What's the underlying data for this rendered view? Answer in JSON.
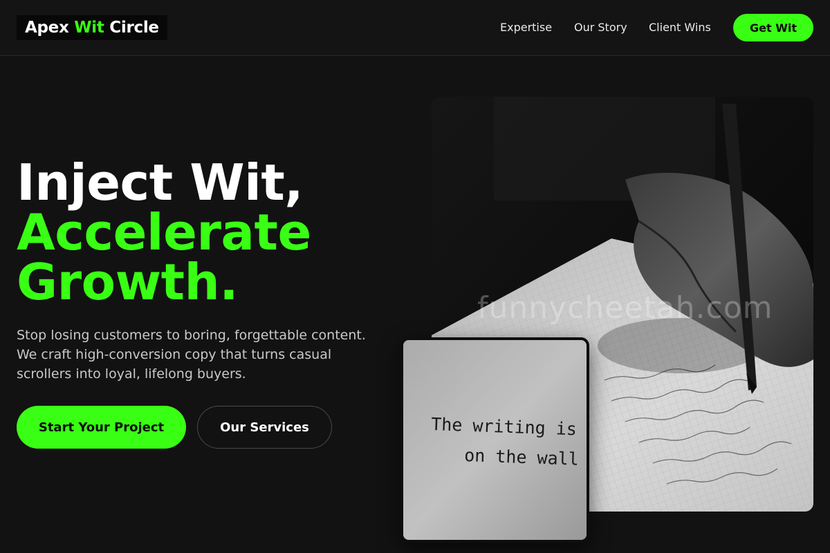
{
  "brand": {
    "name_part1": "Apex",
    "name_part2": "Wit",
    "name_part3": "Circle"
  },
  "nav": {
    "items": [
      {
        "label": "Expertise"
      },
      {
        "label": "Our Story"
      },
      {
        "label": "Client Wins"
      }
    ],
    "cta_label": "Get Wit"
  },
  "hero": {
    "title_line1": "Inject Wit,",
    "title_line2": "Accelerate",
    "title_line3": "Growth.",
    "subtitle": "Stop losing customers to boring, forgettable content. We craft high-conversion copy that turns casual scrollers into loyal, lifelong buyers.",
    "primary_button": "Start Your Project",
    "secondary_button": "Our Services"
  },
  "images": {
    "main_alt": "hand-writing-in-notebook-photo",
    "small_text_line1": "The writing is",
    "small_text_line2": "on the wall",
    "watermark": "funnycheetah.com"
  },
  "colors": {
    "accent": "#39ff14",
    "background": "#121212",
    "header": "#141414"
  }
}
